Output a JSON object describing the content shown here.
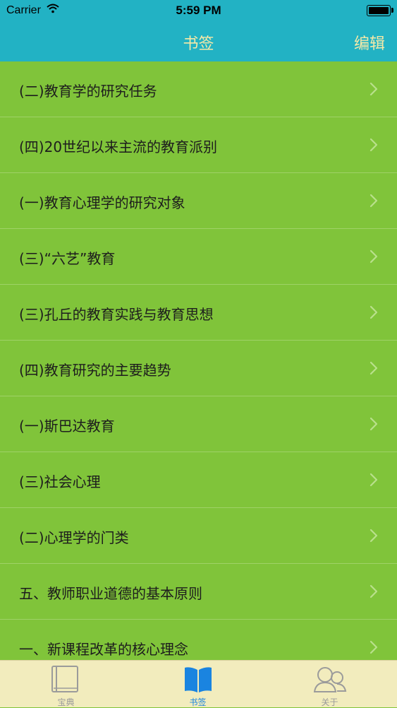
{
  "status_bar": {
    "carrier": "Carrier",
    "time": "5:59 PM"
  },
  "nav": {
    "title": "书签",
    "edit_label": "编辑"
  },
  "bookmarks": [
    {
      "label": "(二)教育学的研究任务"
    },
    {
      "label": "(四)20世纪以来主流的教育派别"
    },
    {
      "label": "(一)教育心理学的研究对象"
    },
    {
      "label": "(三)“六艺”教育"
    },
    {
      "label": "(三)孔丘的教育实践与教育思想"
    },
    {
      "label": "(四)教育研究的主要趋势"
    },
    {
      "label": "(一)斯巴达教育"
    },
    {
      "label": "(三)社会心理"
    },
    {
      "label": "(二)心理学的门类"
    },
    {
      "label": "五、教师职业道德的基本原则"
    },
    {
      "label": "一、新课程改革的核心理念"
    }
  ],
  "tabs": [
    {
      "label": "宝典",
      "icon": "book-icon",
      "active": false
    },
    {
      "label": "书签",
      "icon": "open-book-icon",
      "active": true
    },
    {
      "label": "关于",
      "icon": "people-icon",
      "active": false
    }
  ],
  "colors": {
    "header": "#22b2c4",
    "header_text": "#f5e9a8",
    "list_background": "#80c43a",
    "tab_bar": "#f2ecbd",
    "active_tab": "#1a84e0"
  }
}
